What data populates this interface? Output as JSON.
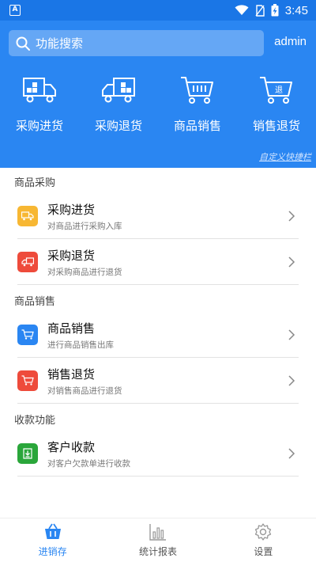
{
  "status_bar": {
    "time": "3:45"
  },
  "header": {
    "search_placeholder": "功能搜索",
    "user": "admin",
    "customize_label": "自定义快捷栏"
  },
  "quick_actions": [
    {
      "label": "采购进货",
      "icon": "truck-icon"
    },
    {
      "label": "采购退货",
      "icon": "truck-icon"
    },
    {
      "label": "商品销售",
      "icon": "cart-icon"
    },
    {
      "label": "销售退货",
      "icon": "cart-return-icon"
    }
  ],
  "sections": [
    {
      "title": "商品采购",
      "items": [
        {
          "title": "采购进货",
          "subtitle": "对商品进行采购入库",
          "icon": "truck-icon",
          "color": "#f7b733"
        },
        {
          "title": "采购退货",
          "subtitle": "对采购商品进行退货",
          "icon": "truck-icon",
          "color": "#ee4b3b"
        }
      ]
    },
    {
      "title": "商品销售",
      "items": [
        {
          "title": "商品销售",
          "subtitle": "进行商品销售出库",
          "icon": "cart-icon",
          "color": "#2a86f2"
        },
        {
          "title": "销售退货",
          "subtitle": "对销售商品进行退货",
          "icon": "cart-icon",
          "color": "#ee4b3b"
        }
      ]
    },
    {
      "title": "收款功能",
      "items": [
        {
          "title": "客户收款",
          "subtitle": "对客户欠款单进行收款",
          "icon": "download-icon",
          "color": "#2aa63a"
        }
      ]
    }
  ],
  "tabs": [
    {
      "label": "进销存",
      "icon": "basket-icon",
      "active": true
    },
    {
      "label": "统计报表",
      "icon": "bar-chart-icon",
      "active": false
    },
    {
      "label": "设置",
      "icon": "gear-icon",
      "active": false
    }
  ],
  "colors": {
    "primary": "#2a86f2",
    "statusbar": "#1a76e6"
  }
}
